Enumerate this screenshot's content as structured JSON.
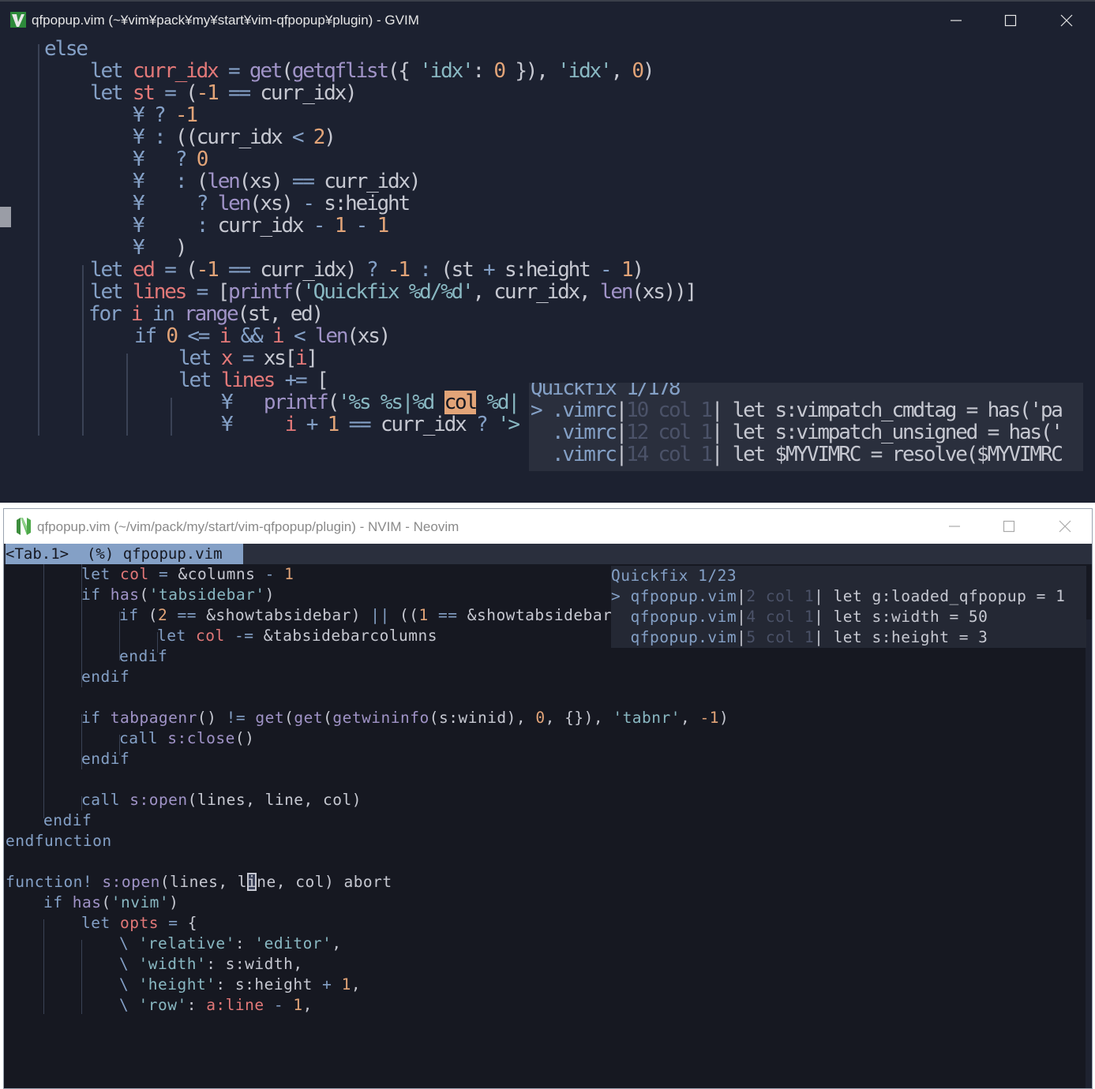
{
  "gvim": {
    "title": "qfpopup.vim (~¥vim¥pack¥my¥start¥vim-qfpopup¥plugin) - GVIM",
    "popup": {
      "header": "Quickfix 1/178",
      "rows": [
        {
          "marker": ">",
          "file": ".vimrc",
          "loc": "10 col 1",
          "text": " let s:vimpatch_cmdtag = has('pa"
        },
        {
          "marker": " ",
          "file": ".vimrc",
          "loc": "12 col 1",
          "text": " let s:vimpatch_unsigned = has('"
        },
        {
          "marker": " ",
          "file": ".vimrc",
          "loc": "14 col 1",
          "text": " let $MYVIMRC = resolve($MYVIMRC"
        }
      ]
    }
  },
  "nvim": {
    "title": "qfpopup.vim (~/vim/pack/my/start/vim-qfpopup/plugin) - NVIM - Neovim",
    "tab_label": "<Tab.1>  (%) qfpopup.vim",
    "popup": {
      "header": "Quickfix 1/23",
      "rows": [
        {
          "marker": ">",
          "file": "qfpopup.vim",
          "loc": "2 col 1",
          "text": " let g:loaded_qfpopup = 1"
        },
        {
          "marker": " ",
          "file": "qfpopup.vim",
          "loc": "4 col 1",
          "text": " let s:width = 50"
        },
        {
          "marker": " ",
          "file": "qfpopup.vim",
          "loc": "5 col 1",
          "text": " let s:height = 3"
        }
      ]
    }
  },
  "colors": {
    "background": "#161821",
    "keyword": "#84a0c6",
    "function": "#a093c7",
    "string": "#89b8c2",
    "number": "#e2a478",
    "variable": "#e27878"
  }
}
